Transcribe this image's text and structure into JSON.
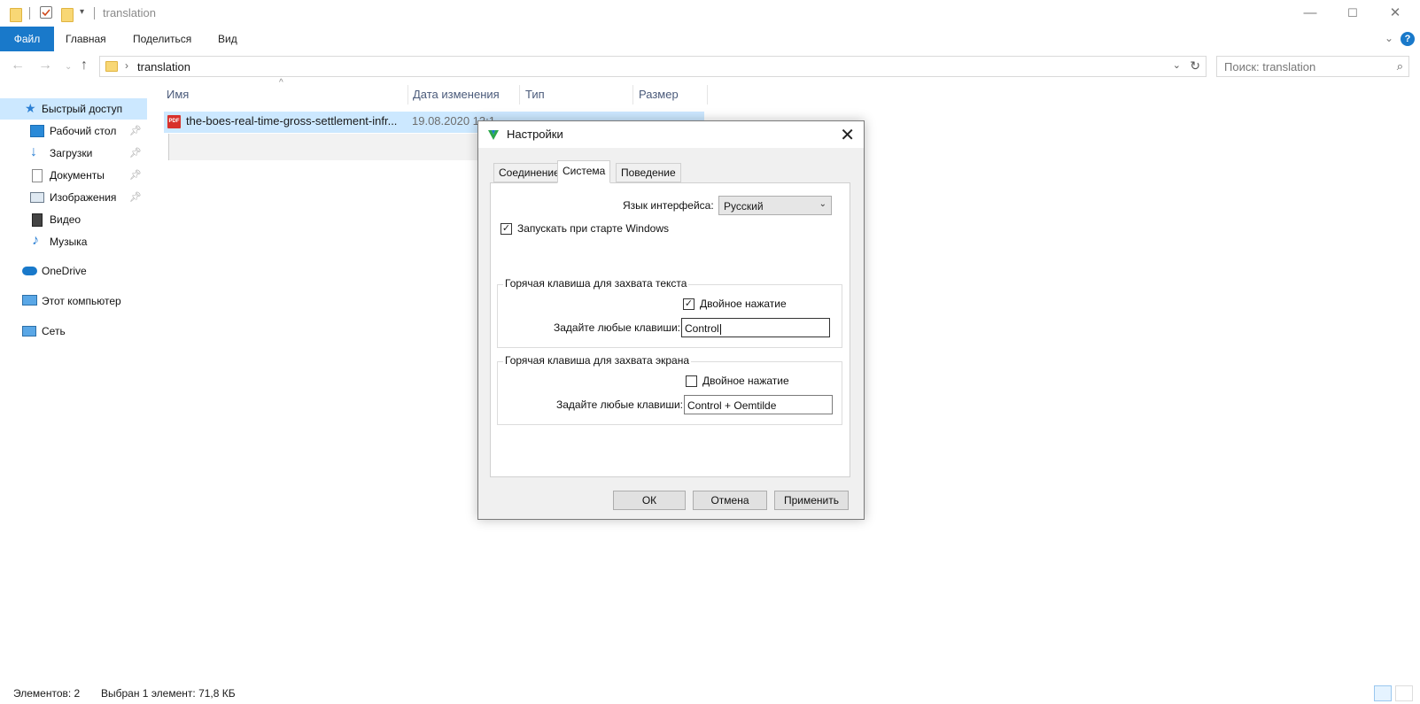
{
  "window": {
    "title": "translation",
    "controls": {
      "minimize": "—",
      "maximize": "☐",
      "close": "✕"
    }
  },
  "ribbon": {
    "tabs": [
      "Файл",
      "Главная",
      "Поделиться",
      "Вид"
    ],
    "help": "?"
  },
  "address": {
    "path": "translation",
    "search_placeholder": "Поиск: translation"
  },
  "sidebar": {
    "items": [
      {
        "label": "Быстрый доступ",
        "icon": "star-icon"
      },
      {
        "label": "Рабочий стол",
        "icon": "desktop-icon",
        "pinned": true
      },
      {
        "label": "Загрузки",
        "icon": "download-icon",
        "pinned": true
      },
      {
        "label": "Документы",
        "icon": "document-icon",
        "pinned": true
      },
      {
        "label": "Изображения",
        "icon": "pictures-icon",
        "pinned": true
      },
      {
        "label": "Видео",
        "icon": "video-icon"
      },
      {
        "label": "Музыка",
        "icon": "music-icon"
      },
      {
        "label": "OneDrive",
        "icon": "cloud-icon"
      },
      {
        "label": "Этот компьютер",
        "icon": "computer-icon"
      },
      {
        "label": "Сеть",
        "icon": "network-icon"
      }
    ]
  },
  "columns": {
    "name": "Имя",
    "date": "Дата изменения",
    "type": "Тип",
    "size": "Размер"
  },
  "files": [
    {
      "name": "the-boes-real-time-gross-settlement-infr...",
      "date": "19.08.2020 13:1",
      "type": "",
      "size": ""
    }
  ],
  "status": {
    "count": "Элементов: 2",
    "selected": "Выбран 1 элемент: 71,8 КБ"
  },
  "dialog": {
    "title": "Настройки",
    "tabs": [
      "Соединение",
      "Система",
      "Поведение"
    ],
    "active_tab": "Система",
    "language_label": "Язык интерфейса:",
    "language_value": "Русский",
    "autostart_label": "Запускать при старте Windows",
    "autostart_checked": true,
    "text_hotkey": {
      "group_label": "Горячая клавиша для захвата текста",
      "double_press_label": "Двойное нажатие",
      "double_press_checked": true,
      "keys_label": "Задайте любые клавиши:",
      "keys_value": "Control"
    },
    "screen_hotkey": {
      "group_label": "Горячая клавиша для захвата экрана",
      "double_press_label": "Двойное нажатие",
      "double_press_checked": false,
      "keys_label": "Задайте любые клавиши:",
      "keys_value": "Control + Oemtilde"
    },
    "buttons": {
      "ok": "ОК",
      "cancel": "Отмена",
      "apply": "Применить"
    }
  },
  "colors": {
    "accent": "#1979ca",
    "selection": "#cce8ff",
    "pdf": "#d8312b"
  }
}
